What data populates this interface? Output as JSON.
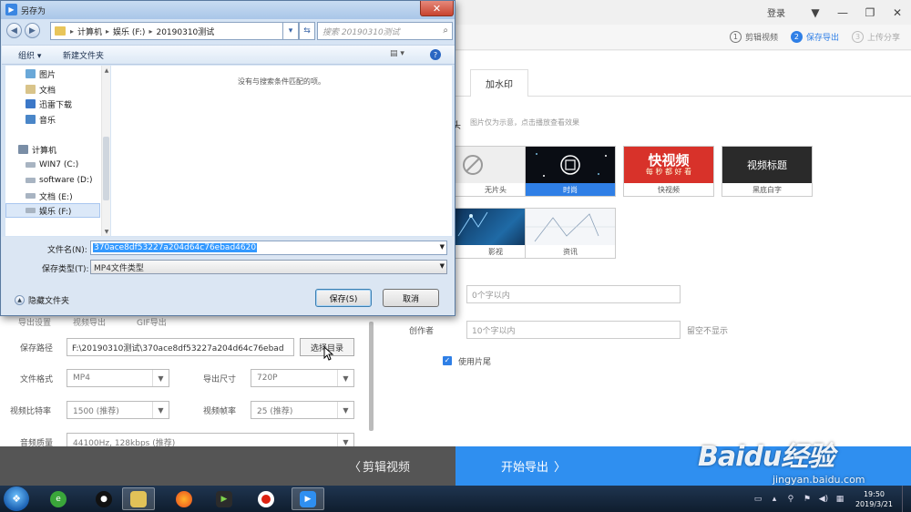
{
  "app": {
    "login": "登录",
    "steps": [
      {
        "num": "1",
        "label": "剪辑视频"
      },
      {
        "num": "2",
        "label": "保存导出"
      },
      {
        "num": "3",
        "label": "上传分享"
      }
    ],
    "tabs": {
      "watermark": "加水印"
    },
    "intro": {
      "title": "头",
      "hint": "图片仅为示意，点击播放查看效果"
    },
    "templates": [
      {
        "label": "无片头",
        "img_text": ""
      },
      {
        "label": "时尚",
        "img_text": ""
      },
      {
        "label": "快视频",
        "img_text": "快视频",
        "img_sub": "每 秒 都 好 看"
      },
      {
        "label": "黑底白字",
        "img_text": "视频标题"
      },
      {
        "label": "影视",
        "img_text": ""
      },
      {
        "label": "资讯",
        "img_text": ""
      }
    ],
    "form": {
      "title_placeholder": "0个字以内",
      "creator_label": "创作者",
      "creator_placeholder": "10个字以内",
      "creator_hint": "留空不显示",
      "use_ending_label": "使用片尾",
      "use_ending_check": "✓"
    },
    "export": {
      "save_path_label": "保存路径",
      "save_path_value": "F:\\20190310测试\\370ace8df53227a204d64c76ebad",
      "choose_dir_button": "选择目录",
      "format_label": "文件格式",
      "format_value": "MP4",
      "size_label": "导出尺寸",
      "size_value": "720P",
      "bitrate_label": "视频比特率",
      "bitrate_value": "1500 (推荐)",
      "fps_label": "视频帧率",
      "fps_value": "25 (推荐)",
      "audio_label": "音频质量",
      "audio_value": "44100Hz, 128kbps (推荐)",
      "export_mode_label": "导出设置",
      "mode_video": "视频导出",
      "mode_gif": "GIF导出"
    },
    "bottom": {
      "edit_video": "剪辑视频",
      "start_export": "开始导出"
    },
    "watermark_logo": "Baidu经验",
    "watermark_url": "jingyan.baidu.com"
  },
  "dialog": {
    "title": "另存为",
    "breadcrumbs": [
      "计算机",
      "娱乐 (F:)",
      "20190310测试"
    ],
    "search_placeholder": "搜索 20190310测试",
    "toolbar": {
      "organize": "组织 ▾",
      "new_folder": "新建文件夹"
    },
    "nav_items": [
      {
        "label": "图片",
        "color": "#6aa8d8"
      },
      {
        "label": "文档",
        "color": "#d9c48a"
      },
      {
        "label": "迅雷下载",
        "color": "#3c78c8"
      },
      {
        "label": "音乐",
        "color": "#4a86c8"
      },
      {
        "label": "计算机",
        "color": "#7a8ea6"
      },
      {
        "label": "WIN7 (C:)",
        "color": "#a8b4c2"
      },
      {
        "label": "software (D:)",
        "color": "#a8b4c2"
      },
      {
        "label": "文档 (E:)",
        "color": "#a8b4c2"
      },
      {
        "label": "娱乐 (F:)",
        "color": "#a8b4c2"
      }
    ],
    "empty_message": "没有与搜索条件匹配的项。",
    "filename_label": "文件名(N):",
    "filename_value": "370ace8df53227a204d64c76ebad4620",
    "filetype_label": "保存类型(T):",
    "filetype_value": "MP4文件类型",
    "hide_folders": "隐藏文件夹",
    "save_button": "保存(S)",
    "cancel_button": "取消"
  },
  "taskbar": {
    "time": "19:50",
    "date": "2019/3/21"
  }
}
